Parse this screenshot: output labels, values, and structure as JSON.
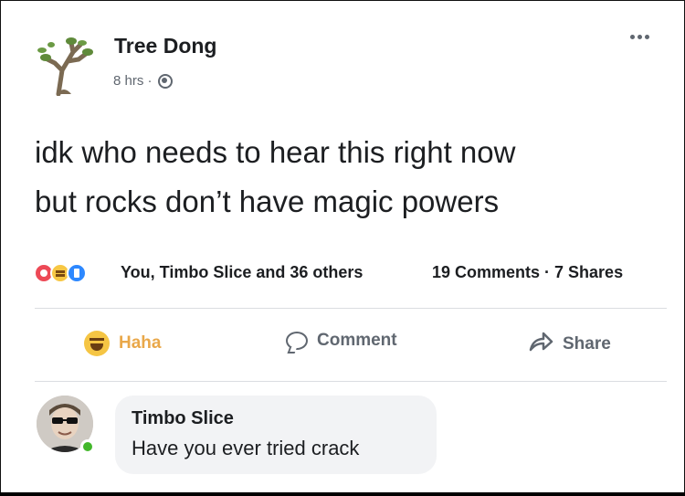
{
  "post": {
    "author": "Tree Dong",
    "time": "8 hrs ·",
    "privacy_icon": "globe-icon",
    "text_lines": [
      "idk who needs to hear this right now",
      "but rocks don’t have magic powers"
    ]
  },
  "reactions": {
    "icons": [
      "love-reaction-icon",
      "haha-reaction-icon",
      "like-reaction-icon"
    ],
    "summary": "You, Timbo Slice and 36 others",
    "counts": "19 Comments · 7 Shares"
  },
  "actions": {
    "haha_label": "Haha",
    "comment_label": "Comment",
    "share_label": "Share"
  },
  "comment": {
    "author": "Timbo Slice",
    "text": "Have you ever tried crack"
  },
  "colors": {
    "haha_accent": "#e9a84a",
    "online": "#42b72a",
    "bubble_bg": "#f2f3f5"
  }
}
